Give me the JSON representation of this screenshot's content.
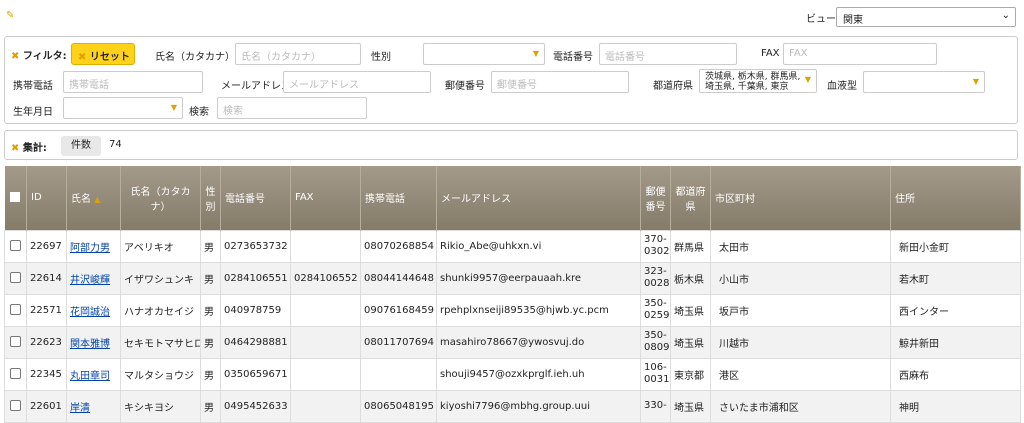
{
  "topbar": {
    "view_label": "ビュー",
    "view_value": "関東"
  },
  "filter": {
    "title": "フィルタ:",
    "reset_label": "リセット",
    "fields": {
      "name_kana": {
        "label": "氏名（カタカナ）",
        "placeholder": "氏名（カタカナ）"
      },
      "gender": {
        "label": "性別",
        "value": ""
      },
      "phone": {
        "label": "電話番号",
        "placeholder": "電話番号"
      },
      "fax": {
        "label": "FAX",
        "placeholder": "FAX"
      },
      "mobile": {
        "label": "携帯電話",
        "placeholder": "携帯電話"
      },
      "email": {
        "label": "メールアドレス",
        "placeholder": "メールアドレス"
      },
      "postal": {
        "label": "郵便番号",
        "placeholder": "郵便番号"
      },
      "prefecture": {
        "label": "都道府県",
        "value": "茨城県, 栃木県, 群馬県, 埼玉県, 千葉県, 東京"
      },
      "blood": {
        "label": "血液型",
        "value": ""
      },
      "birthday": {
        "label": "生年月日",
        "value": ""
      },
      "search": {
        "label": "検索",
        "placeholder": "検索"
      }
    }
  },
  "aggregate": {
    "title": "集計:",
    "count_label": "件数",
    "count_value": "74"
  },
  "table": {
    "headers": {
      "id": "ID",
      "name": "氏名",
      "kana": "氏名（カタカナ）",
      "gender": "性別",
      "phone": "電話番号",
      "fax": "FAX",
      "mobile": "携帯電話",
      "email": "メールアドレス",
      "postal": "郵便番号",
      "pref": "都道府県",
      "city": "市区町村",
      "address": "住所"
    },
    "rows": [
      {
        "id": "22697",
        "name": "阿部力男",
        "kana": "アベリキオ",
        "gender": "男",
        "phone": "0273653732",
        "fax": "",
        "mobile": "08070268854",
        "email": "Rikio_Abe@uhkxn.vi",
        "postal": "370-0302",
        "pref": "群馬県",
        "city": "太田市",
        "address": "新田小金町"
      },
      {
        "id": "22614",
        "name": "井沢峻輝",
        "kana": "イザワシュンキ",
        "gender": "男",
        "phone": "0284106551",
        "fax": "0284106552",
        "mobile": "08044144648",
        "email": "shunki9957@eerpauaah.kre",
        "postal": "323-0028",
        "pref": "栃木県",
        "city": "小山市",
        "address": "若木町"
      },
      {
        "id": "22571",
        "name": "花岡誠治",
        "kana": "ハナオカセイジ",
        "gender": "男",
        "phone": "040978759",
        "fax": "",
        "mobile": "09076168459",
        "email": "rpehplxnseiji89535@hjwb.yc.pcm",
        "postal": "350-0259",
        "pref": "埼玉県",
        "city": "坂戸市",
        "address": "西インター"
      },
      {
        "id": "22623",
        "name": "関本雅博",
        "kana": "セキモトマサヒロ",
        "gender": "男",
        "phone": "0464298881",
        "fax": "",
        "mobile": "08011707694",
        "email": "masahiro78667@ywosvuj.do",
        "postal": "350-0809",
        "pref": "埼玉県",
        "city": "川越市",
        "address": "鯨井新田"
      },
      {
        "id": "22345",
        "name": "丸田章司",
        "kana": "マルタショウジ",
        "gender": "男",
        "phone": "0350659671",
        "fax": "",
        "mobile": "",
        "email": "shouji9457@ozxkprglf.ieh.uh",
        "postal": "106-0031",
        "pref": "東京都",
        "city": "港区",
        "address": "西麻布"
      },
      {
        "id": "22601",
        "name": "岸清",
        "kana": "キシキヨシ",
        "gender": "男",
        "phone": "0495452633",
        "fax": "",
        "mobile": "08065048195",
        "email": "kiyoshi7796@mbhg.group.uui",
        "postal": "330-",
        "pref": "埼玉県",
        "city": "さいたま市浦和区",
        "address": "神明"
      }
    ]
  }
}
